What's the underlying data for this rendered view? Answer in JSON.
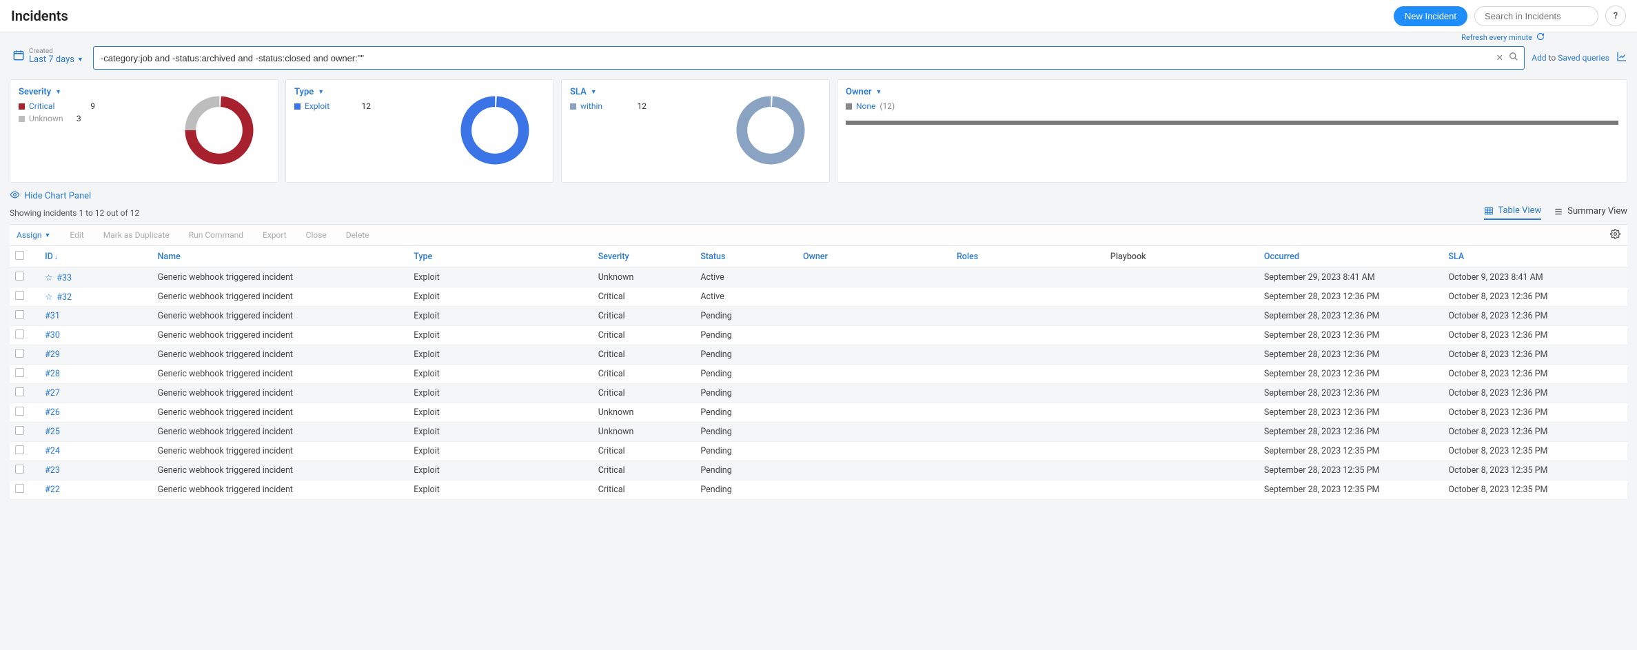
{
  "header": {
    "title": "Incidents",
    "new_button": "New Incident",
    "search_placeholder": "Search in Incidents",
    "help": "?"
  },
  "query": {
    "date_label": "Created",
    "date_value": "Last 7 days",
    "text": "-category:job and -status:archived and -status:closed and owner:\"\"",
    "refresh": "Refresh every minute",
    "add": "Add",
    "to": "to",
    "saved": "Saved queries"
  },
  "panels": {
    "severity": {
      "title": "Severity",
      "items": [
        {
          "label": "Critical",
          "value": "9",
          "color": "#a8212f"
        },
        {
          "label": "Unknown",
          "value": "3",
          "color": "#bdbdbd"
        }
      ]
    },
    "type": {
      "title": "Type",
      "items": [
        {
          "label": "Exploit",
          "value": "12",
          "color": "#3a74e6"
        }
      ]
    },
    "sla": {
      "title": "SLA",
      "items": [
        {
          "label": "within",
          "value": "12",
          "color": "#8aa3c2"
        }
      ]
    },
    "owner": {
      "title": "Owner",
      "none_label": "None",
      "none_count": "(12)"
    }
  },
  "chart_data": [
    {
      "type": "pie",
      "title": "Severity",
      "series": [
        {
          "name": "Critical",
          "value": 9,
          "color": "#a8212f"
        },
        {
          "name": "Unknown",
          "value": 3,
          "color": "#bdbdbd"
        }
      ]
    },
    {
      "type": "pie",
      "title": "Type",
      "series": [
        {
          "name": "Exploit",
          "value": 12,
          "color": "#3a74e6"
        }
      ]
    },
    {
      "type": "pie",
      "title": "SLA",
      "series": [
        {
          "name": "within",
          "value": 12,
          "color": "#8aa3c2"
        }
      ]
    },
    {
      "type": "bar",
      "title": "Owner",
      "categories": [
        "None"
      ],
      "values": [
        12
      ]
    }
  ],
  "below": {
    "hide_chart": "Hide Chart Panel",
    "count_text": "Showing incidents 1 to 12 out of 12",
    "table_view": "Table View",
    "summary_view": "Summary View"
  },
  "actions": {
    "assign": "Assign",
    "edit": "Edit",
    "dup": "Mark as Duplicate",
    "run": "Run Command",
    "export": "Export",
    "close": "Close",
    "delete": "Delete"
  },
  "table": {
    "columns": [
      "ID",
      "Name",
      "Type",
      "Severity",
      "Status",
      "Owner",
      "Roles",
      "Playbook",
      "Occurred",
      "SLA"
    ],
    "rows": [
      {
        "star": true,
        "id": "#33",
        "name": "Generic webhook triggered incident",
        "type": "Exploit",
        "sev": "Unknown",
        "status": "Active",
        "owner": "",
        "roles": "",
        "play": "",
        "occ": "September 29, 2023 8:41 AM",
        "sla": "October 9, 2023 8:41 AM"
      },
      {
        "star": true,
        "id": "#32",
        "name": "Generic webhook triggered incident",
        "type": "Exploit",
        "sev": "Critical",
        "status": "Active",
        "owner": "",
        "roles": "",
        "play": "",
        "occ": "September 28, 2023 12:36 PM",
        "sla": "October 8, 2023 12:36 PM"
      },
      {
        "star": false,
        "id": "#31",
        "name": "Generic webhook triggered incident",
        "type": "Exploit",
        "sev": "Critical",
        "status": "Pending",
        "owner": "",
        "roles": "",
        "play": "",
        "occ": "September 28, 2023 12:36 PM",
        "sla": "October 8, 2023 12:36 PM"
      },
      {
        "star": false,
        "id": "#30",
        "name": "Generic webhook triggered incident",
        "type": "Exploit",
        "sev": "Critical",
        "status": "Pending",
        "owner": "",
        "roles": "",
        "play": "",
        "occ": "September 28, 2023 12:36 PM",
        "sla": "October 8, 2023 12:36 PM"
      },
      {
        "star": false,
        "id": "#29",
        "name": "Generic webhook triggered incident",
        "type": "Exploit",
        "sev": "Critical",
        "status": "Pending",
        "owner": "",
        "roles": "",
        "play": "",
        "occ": "September 28, 2023 12:36 PM",
        "sla": "October 8, 2023 12:36 PM"
      },
      {
        "star": false,
        "id": "#28",
        "name": "Generic webhook triggered incident",
        "type": "Exploit",
        "sev": "Critical",
        "status": "Pending",
        "owner": "",
        "roles": "",
        "play": "",
        "occ": "September 28, 2023 12:36 PM",
        "sla": "October 8, 2023 12:36 PM"
      },
      {
        "star": false,
        "id": "#27",
        "name": "Generic webhook triggered incident",
        "type": "Exploit",
        "sev": "Critical",
        "status": "Pending",
        "owner": "",
        "roles": "",
        "play": "",
        "occ": "September 28, 2023 12:36 PM",
        "sla": "October 8, 2023 12:36 PM"
      },
      {
        "star": false,
        "id": "#26",
        "name": "Generic webhook triggered incident",
        "type": "Exploit",
        "sev": "Unknown",
        "status": "Pending",
        "owner": "",
        "roles": "",
        "play": "",
        "occ": "September 28, 2023 12:36 PM",
        "sla": "October 8, 2023 12:36 PM"
      },
      {
        "star": false,
        "id": "#25",
        "name": "Generic webhook triggered incident",
        "type": "Exploit",
        "sev": "Unknown",
        "status": "Pending",
        "owner": "",
        "roles": "",
        "play": "",
        "occ": "September 28, 2023 12:36 PM",
        "sla": "October 8, 2023 12:36 PM"
      },
      {
        "star": false,
        "id": "#24",
        "name": "Generic webhook triggered incident",
        "type": "Exploit",
        "sev": "Critical",
        "status": "Pending",
        "owner": "",
        "roles": "",
        "play": "",
        "occ": "September 28, 2023 12:35 PM",
        "sla": "October 8, 2023 12:35 PM"
      },
      {
        "star": false,
        "id": "#23",
        "name": "Generic webhook triggered incident",
        "type": "Exploit",
        "sev": "Critical",
        "status": "Pending",
        "owner": "",
        "roles": "",
        "play": "",
        "occ": "September 28, 2023 12:35 PM",
        "sla": "October 8, 2023 12:35 PM"
      },
      {
        "star": false,
        "id": "#22",
        "name": "Generic webhook triggered incident",
        "type": "Exploit",
        "sev": "Critical",
        "status": "Pending",
        "owner": "",
        "roles": "",
        "play": "",
        "occ": "September 28, 2023 12:35 PM",
        "sla": "October 8, 2023 12:35 PM"
      }
    ]
  }
}
